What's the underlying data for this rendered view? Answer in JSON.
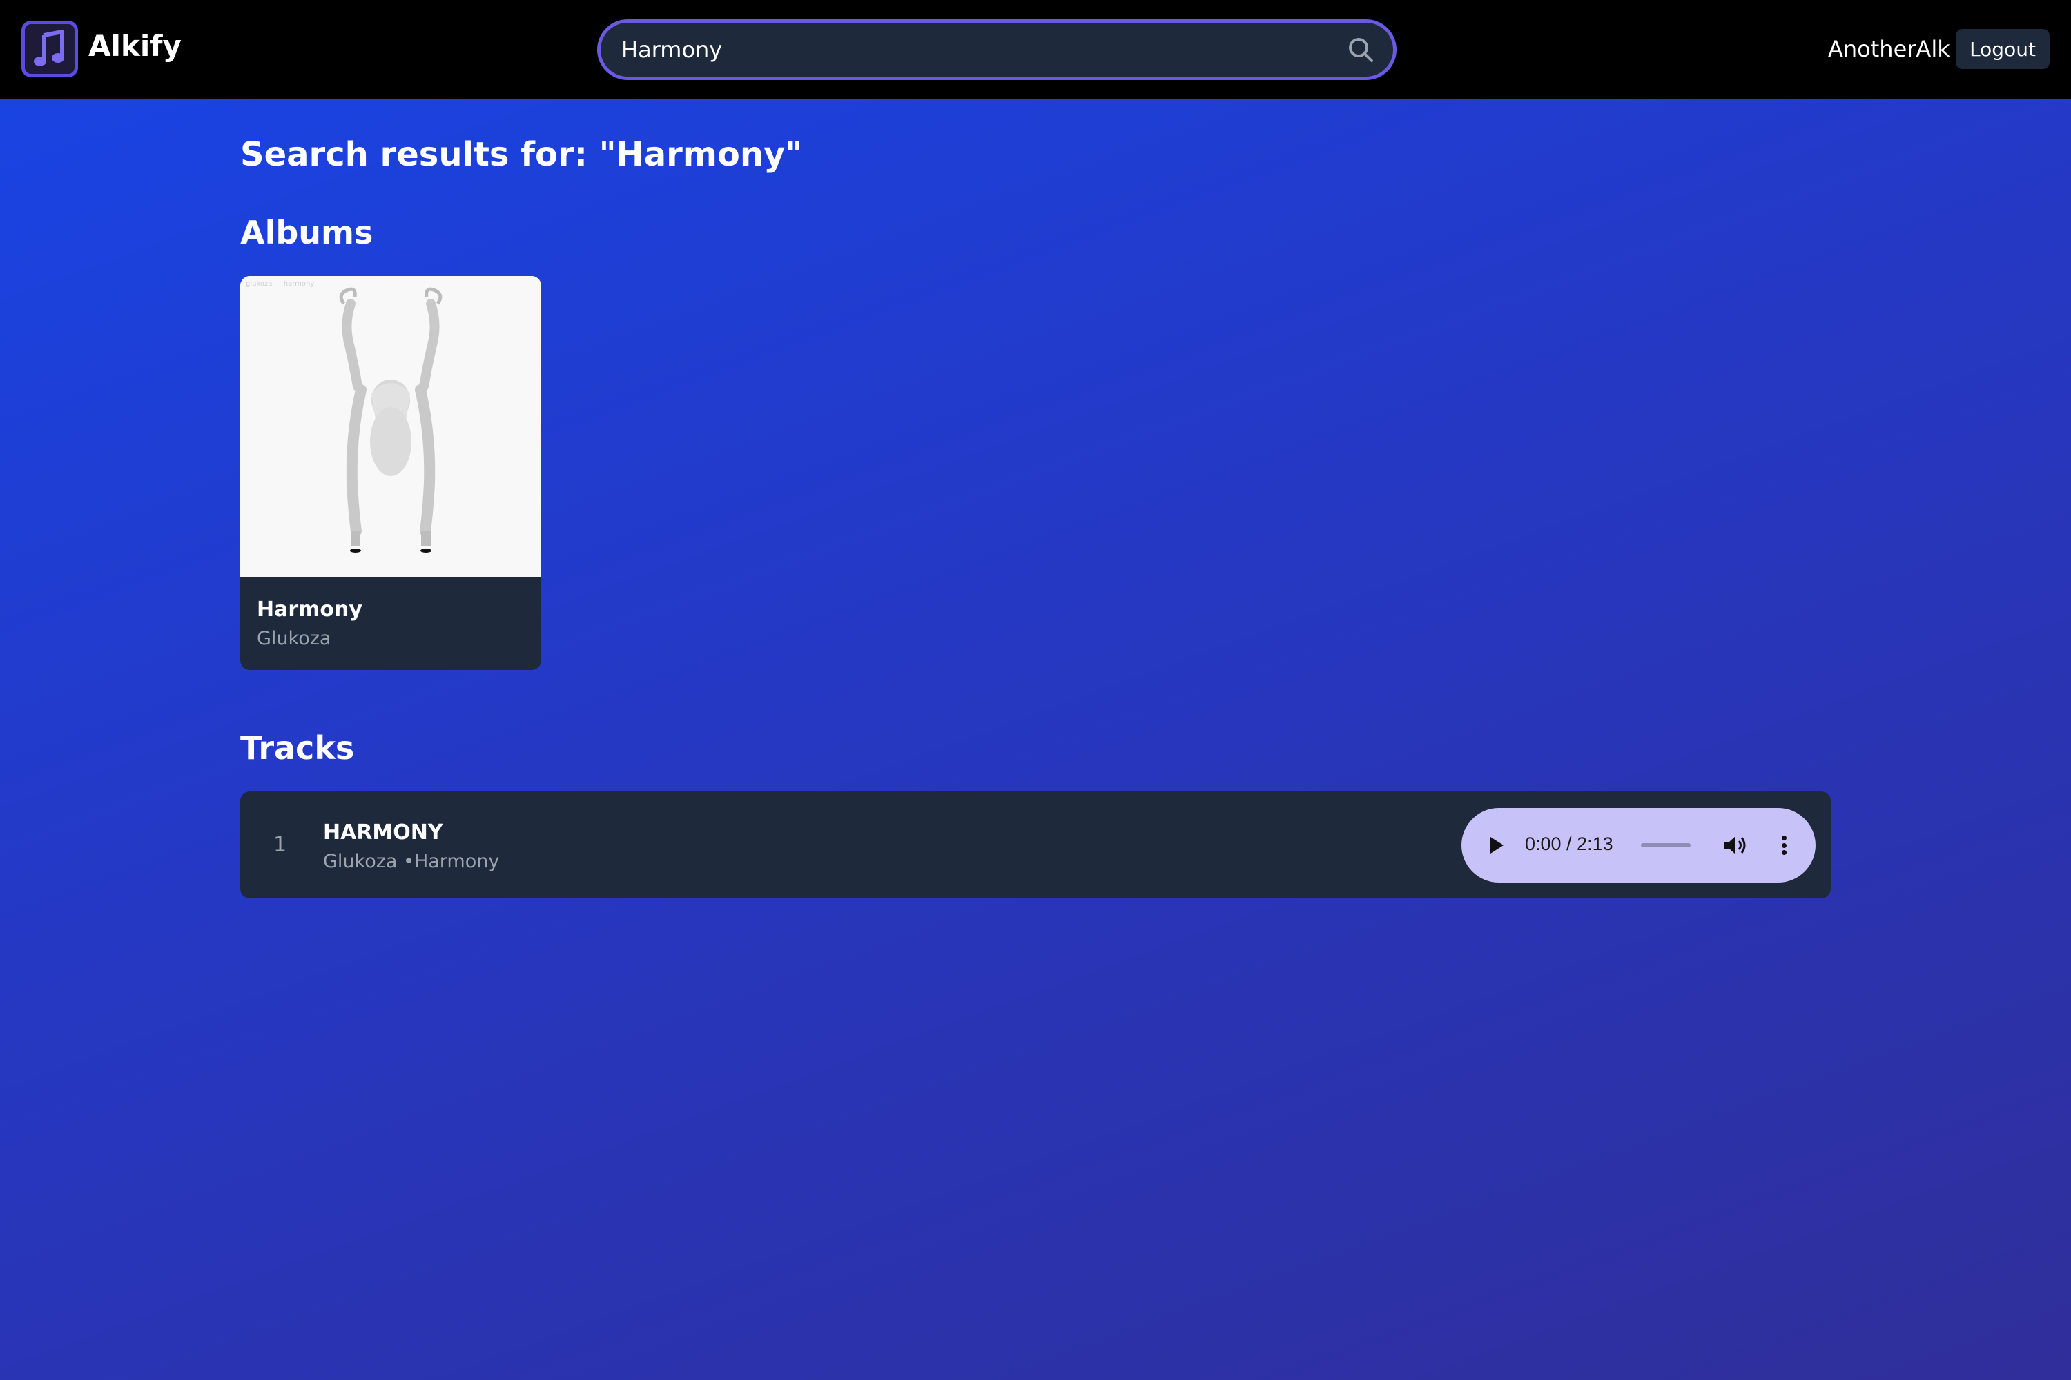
{
  "header": {
    "app_name": "Alkify",
    "search": {
      "value": "Harmony",
      "placeholder": ""
    },
    "username": "AnotherAlk",
    "logout_label": "Logout"
  },
  "main": {
    "results_title": "Search results for: \"Harmony\"",
    "albums_heading": "Albums",
    "albums": [
      {
        "name": "Harmony",
        "artist": "Glukoza"
      }
    ],
    "tracks_heading": "Tracks",
    "tracks": [
      {
        "number": "1",
        "title": "HARMONY",
        "meta": "Glukoza •Harmony",
        "player": {
          "time": "0:00 / 2:13"
        }
      }
    ]
  },
  "icons": {
    "logo": "music-note-icon",
    "search": "search-icon",
    "play": "play-icon",
    "volume": "volume-icon",
    "more": "more-vertical-icon"
  },
  "colors": {
    "accent": "#6a5ae0",
    "header_bg": "#000000",
    "card_bg": "#1e293b",
    "player_bg": "#c7c2f7",
    "bg_start": "#1845e6",
    "bg_end": "#302e9a"
  }
}
